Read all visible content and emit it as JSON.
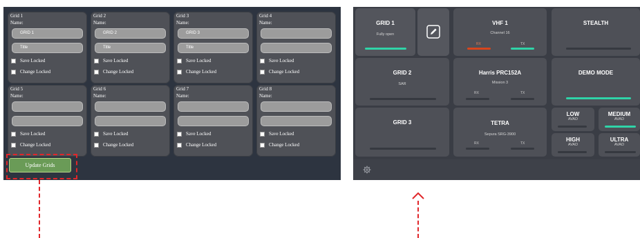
{
  "grid_editor": {
    "cards": [
      {
        "title": "Grid 1",
        "name_label": "Name:",
        "name_value": "GRID 1",
        "sub_value": "Title",
        "save_locked": "Save Locked",
        "change_locked": "Change Locked"
      },
      {
        "title": "Grid 2",
        "name_label": "Name:",
        "name_value": "GRID 2",
        "sub_value": "Title",
        "save_locked": "Save Locked",
        "change_locked": "Change Locked"
      },
      {
        "title": "Grid 3",
        "name_label": "Name:",
        "name_value": "GRID 3",
        "sub_value": "Title",
        "save_locked": "Save Locked",
        "change_locked": "Change Locked"
      },
      {
        "title": "Grid 4",
        "name_label": "Name:",
        "name_value": "",
        "sub_value": "",
        "save_locked": "Save Locked",
        "change_locked": "Change Locked"
      },
      {
        "title": "Grid 5",
        "name_label": "Name:",
        "name_value": "",
        "sub_value": "",
        "save_locked": "Save Locked",
        "change_locked": "Change Locked"
      },
      {
        "title": "Grid 6",
        "name_label": "Name:",
        "name_value": "",
        "sub_value": "",
        "save_locked": "Save Locked",
        "change_locked": "Change Locked"
      },
      {
        "title": "Grid 7",
        "name_label": "Name:",
        "name_value": "",
        "sub_value": "",
        "save_locked": "Save Locked",
        "change_locked": "Change Locked"
      },
      {
        "title": "Grid 8",
        "name_label": "Name:",
        "name_value": "",
        "sub_value": "",
        "save_locked": "Save Locked",
        "change_locked": "Change Locked"
      }
    ],
    "update_button": "Update Grids"
  },
  "control_grid": {
    "grid1": {
      "title": "GRID 1",
      "subtitle": "Fully open"
    },
    "edit_icon": "pencil-icon",
    "vhf1": {
      "title": "VHF 1",
      "subtitle": "Channel 16",
      "rx": "RX",
      "tx": "TX"
    },
    "stealth": {
      "title": "STEALTH"
    },
    "grid2": {
      "title": "GRID 2",
      "subtitle": "SAR"
    },
    "harris": {
      "title": "Harris PRC152A",
      "subtitle": "Mission 3",
      "rx": "RX",
      "tx": "TX"
    },
    "demo": {
      "title": "DEMO MODE"
    },
    "grid3": {
      "title": "GRID 3"
    },
    "tetra": {
      "title": "TETRA",
      "subtitle": "Sepura SRG-3900",
      "rx": "RX",
      "tx": "TX"
    },
    "low": {
      "title": "LOW",
      "subtitle": "AVAD"
    },
    "medium": {
      "title": "MEDIUM",
      "subtitle": "AVAD"
    },
    "high": {
      "title": "HIGH",
      "subtitle": "AVAD"
    },
    "ultra": {
      "title": "ULTRA",
      "subtitle": "AVAD"
    },
    "settings_icon": "gear-icon"
  },
  "colors": {
    "active": "#2fd4a8",
    "transmit_alert": "#d8451c",
    "highlight": "#e0262a",
    "update_button": "#6a9b57"
  }
}
